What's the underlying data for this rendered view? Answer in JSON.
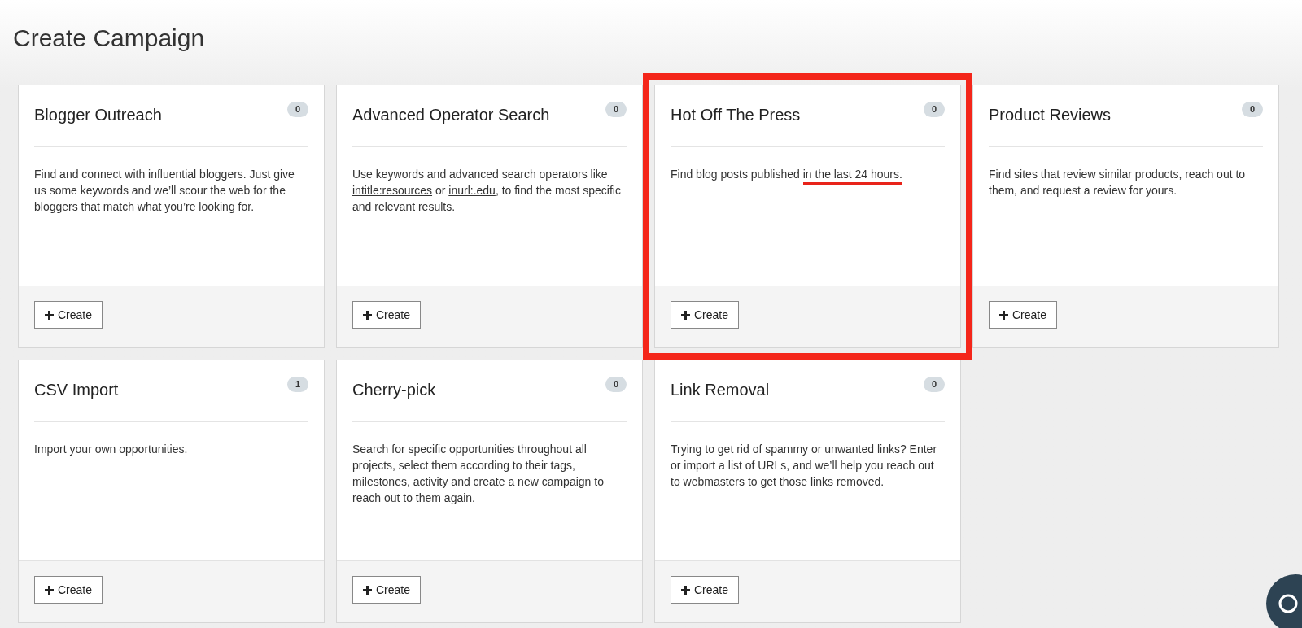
{
  "page_title": "Create Campaign",
  "cards": [
    {
      "title": "Blogger Outreach",
      "count": "0",
      "annotated": false,
      "description": [
        {
          "kind": "plain",
          "text": "Find and connect with influential bloggers. Just give us some keywords and we’ll scour the web for the bloggers that match what you’re looking for."
        }
      ],
      "button": "Create"
    },
    {
      "title": "Advanced Operator Search",
      "count": "0",
      "annotated": false,
      "description": [
        {
          "kind": "plain",
          "text": "Use keywords and advanced search operators like "
        },
        {
          "kind": "link",
          "text": "intitle:resources"
        },
        {
          "kind": "plain",
          "text": " or "
        },
        {
          "kind": "link",
          "text": "inurl:.edu"
        },
        {
          "kind": "plain",
          "text": ", to find the most specific and relevant results."
        }
      ],
      "button": "Create"
    },
    {
      "title": "Hot Off The Press",
      "count": "0",
      "annotated": true,
      "description": [
        {
          "kind": "plain",
          "text": "Find blog posts published "
        },
        {
          "kind": "marked",
          "text": "in the last 24 hours."
        }
      ],
      "button": "Create"
    },
    {
      "title": "Product Reviews",
      "count": "0",
      "annotated": false,
      "description": [
        {
          "kind": "plain",
          "text": "Find sites that review similar products, reach out to them, and request a review for yours."
        }
      ],
      "button": "Create"
    },
    {
      "title": "CSV Import",
      "count": "1",
      "annotated": false,
      "description": [
        {
          "kind": "plain",
          "text": "Import your own opportunities."
        }
      ],
      "button": "Create"
    },
    {
      "title": "Cherry-pick",
      "count": "0",
      "annotated": false,
      "description": [
        {
          "kind": "plain",
          "text": "Search for specific opportunities throughout all projects, select them according to their tags, milestones, activity and create a new campaign to reach out to them again."
        }
      ],
      "button": "Create"
    },
    {
      "title": "Link Removal",
      "count": "0",
      "annotated": false,
      "description": [
        {
          "kind": "plain",
          "text": "Trying to get rid of spammy or unwanted links? Enter or import a list of URLs, and we’ll help you reach out to webmasters to get those links removed."
        }
      ],
      "button": "Create"
    }
  ]
}
